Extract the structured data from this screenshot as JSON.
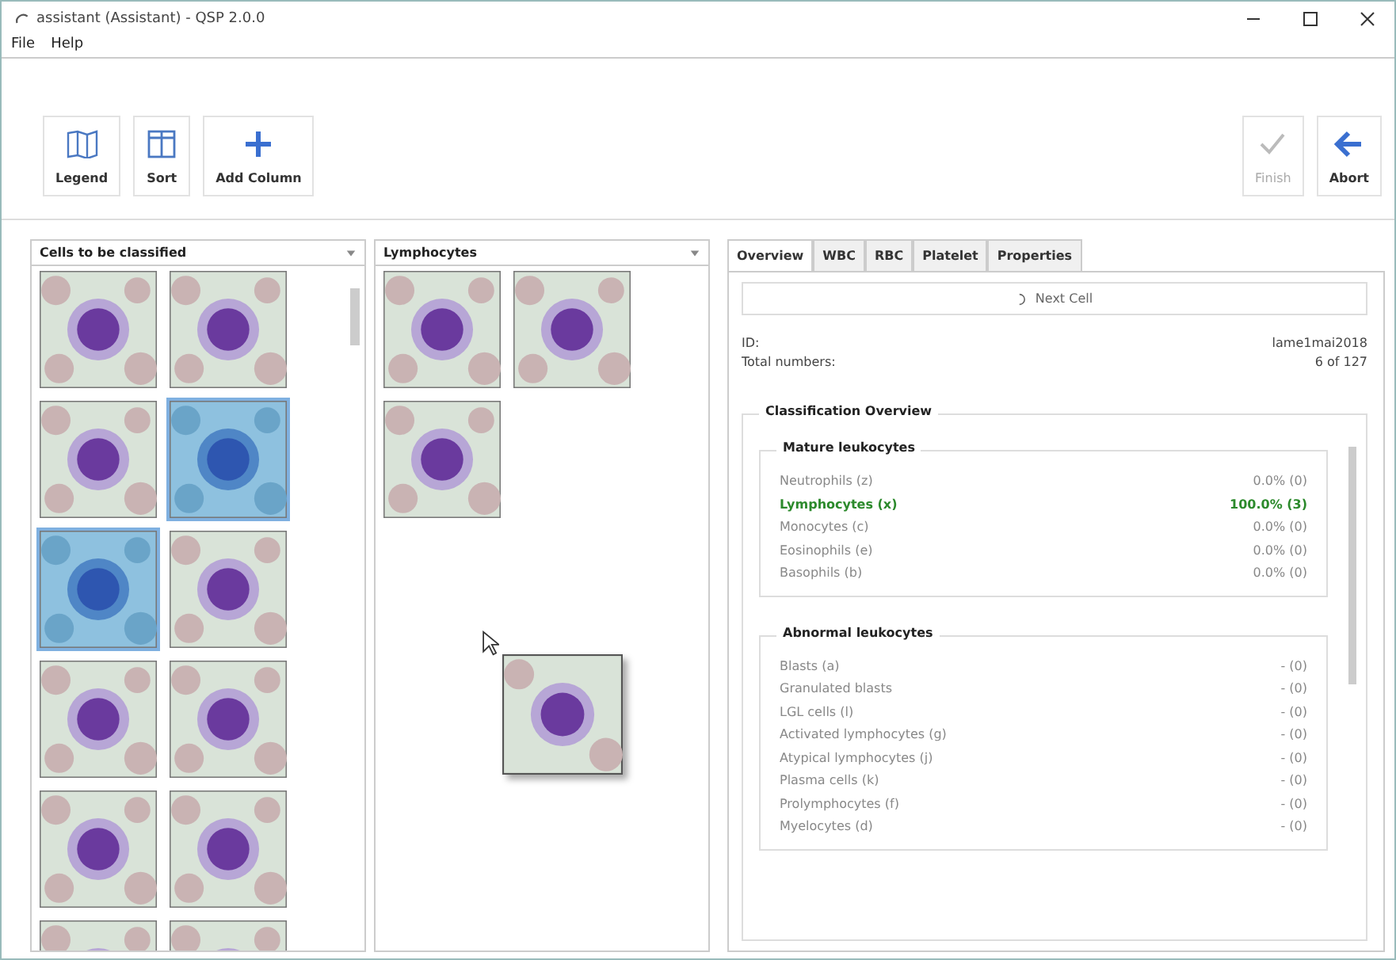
{
  "window": {
    "title": "assistant (Assistant) - QSP 2.0.0"
  },
  "menu": [
    "File",
    "Help"
  ],
  "toolbar_left": [
    {
      "kind": "legend",
      "label": "Legend"
    },
    {
      "kind": "sort",
      "label": "Sort"
    },
    {
      "kind": "add",
      "label": "Add Column"
    }
  ],
  "toolbar_right": [
    {
      "kind": "finish",
      "label": "Finish",
      "disabled": true
    },
    {
      "kind": "abort",
      "label": "Abort",
      "disabled": false
    }
  ],
  "columns": [
    {
      "title": "Cells to be classified",
      "cells": [
        {
          "selected": false
        },
        {
          "selected": false
        },
        {
          "selected": false
        },
        {
          "selected": true
        },
        {
          "selected": true
        },
        {
          "selected": false
        },
        {
          "selected": false
        },
        {
          "selected": false
        },
        {
          "selected": false
        },
        {
          "selected": false
        },
        {
          "selected": false
        },
        {
          "selected": false
        }
      ]
    },
    {
      "title": "Lymphocytes",
      "cells": [
        {
          "selected": false
        },
        {
          "selected": false
        },
        {
          "selected": false
        }
      ]
    }
  ],
  "tabs": [
    {
      "label": "Overview",
      "selected": true
    },
    {
      "label": "WBC",
      "selected": false
    },
    {
      "label": "RBC",
      "selected": false
    },
    {
      "label": "Platelet",
      "selected": false
    },
    {
      "label": "Properties",
      "selected": false
    }
  ],
  "next_button": "Next Cell",
  "info": [
    {
      "label": "ID:",
      "value": "lame1mai2018"
    },
    {
      "label": "Total numbers:",
      "value": "6 of 127"
    }
  ],
  "overview": {
    "title": "Classification Overview",
    "groups": [
      {
        "title": "Mature leukocytes",
        "rows": [
          {
            "name": "Neutrophils (z)",
            "value": "0.0% (0)",
            "selected": false
          },
          {
            "name": "Lymphocytes (x)",
            "value": "100.0% (3)",
            "selected": true
          },
          {
            "name": "Monocytes (c)",
            "value": "0.0% (0)",
            "selected": false
          },
          {
            "name": "Eosinophils (e)",
            "value": "0.0% (0)",
            "selected": false
          },
          {
            "name": "Basophils (b)",
            "value": "0.0% (0)",
            "selected": false
          }
        ]
      },
      {
        "title": "Abnormal leukocytes",
        "rows": [
          {
            "name": "Blasts (a)",
            "value": "- (0)",
            "selected": false
          },
          {
            "name": "Granulated blasts",
            "value": "- (0)",
            "selected": false
          },
          {
            "name": "LGL cells (l)",
            "value": "- (0)",
            "selected": false
          },
          {
            "name": "Activated lymphocytes (g)",
            "value": "- (0)",
            "selected": false
          },
          {
            "name": "Atypical lymphocytes (j)",
            "value": "- (0)",
            "selected": false
          },
          {
            "name": "Plasma cells (k)",
            "value": "- (0)",
            "selected": false
          },
          {
            "name": "Prolymphocytes (f)",
            "value": "- (0)",
            "selected": false
          },
          {
            "name": "Myelocytes (d)",
            "value": "- (0)",
            "selected": false
          }
        ]
      }
    ]
  }
}
